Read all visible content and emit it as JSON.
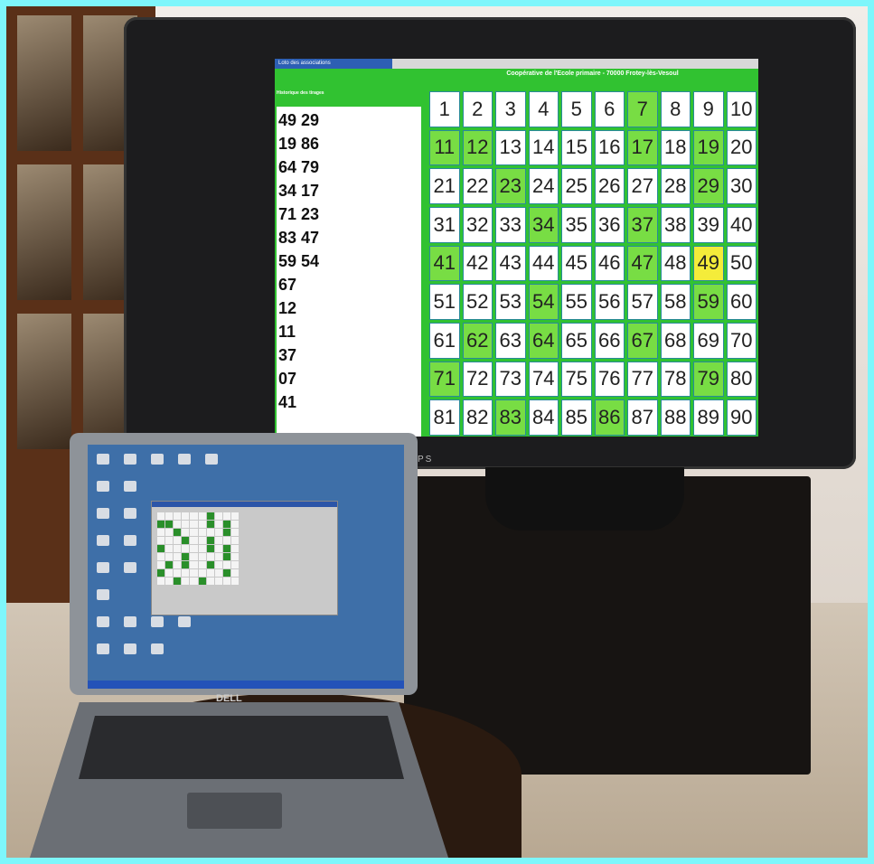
{
  "tv": {
    "brand": "PHILIPS",
    "window_title": "Loto des associations",
    "header": "Coopérative de l'Ecole primaire - 70000 Frotey-lès-Vesoul",
    "history_label": "Historique des tirages",
    "history_rows": [
      "49  29",
      "19  86",
      "64  79",
      "34  17",
      "71  23",
      "83  47",
      "59  54",
      "67",
      "12",
      "11",
      "37",
      "07",
      "41"
    ],
    "board_numbers": [
      1,
      2,
      3,
      4,
      5,
      6,
      7,
      8,
      9,
      10,
      11,
      12,
      13,
      14,
      15,
      16,
      17,
      18,
      19,
      20,
      21,
      22,
      23,
      24,
      25,
      26,
      27,
      28,
      29,
      30,
      31,
      32,
      33,
      34,
      35,
      36,
      37,
      38,
      39,
      40,
      41,
      42,
      43,
      44,
      45,
      46,
      47,
      48,
      49,
      50,
      51,
      52,
      53,
      54,
      55,
      56,
      57,
      58,
      59,
      60,
      61,
      62,
      63,
      64,
      65,
      66,
      67,
      68,
      69,
      70,
      71,
      72,
      73,
      74,
      75,
      76,
      77,
      78,
      79,
      80,
      81,
      82,
      83,
      84,
      85,
      86,
      87,
      88,
      89,
      90
    ],
    "drawn_numbers": [
      7,
      11,
      12,
      17,
      19,
      23,
      29,
      34,
      37,
      41,
      47,
      54,
      59,
      62,
      64,
      67,
      71,
      79,
      83,
      86
    ],
    "last_drawn": 49,
    "colors": {
      "board_bg": "#31c231",
      "drawn": "#78dd44",
      "last": "#f4ec3a",
      "cell": "#ffffff"
    }
  },
  "laptop": {
    "brand": "DELL",
    "app_title": "Loto des associations - Contrôle de la partie"
  }
}
